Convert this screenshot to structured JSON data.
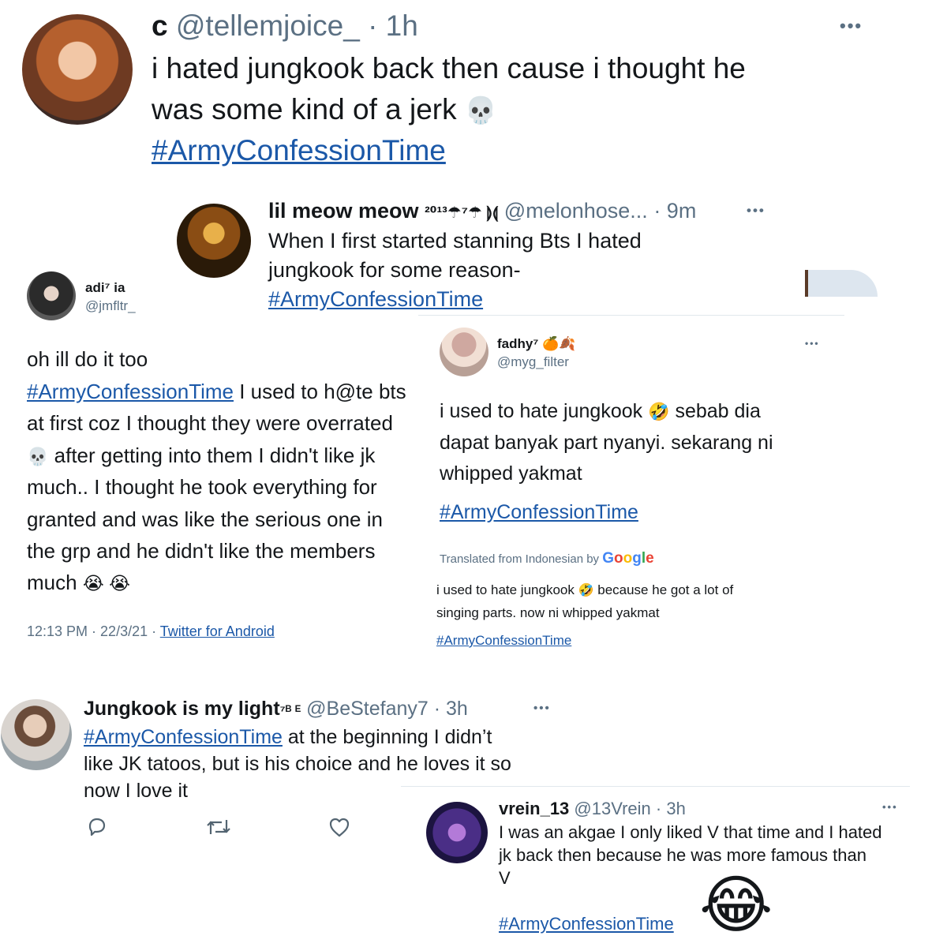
{
  "t1": {
    "name": "c",
    "handle": "@tellemjoice_",
    "time": "· 1h",
    "lines": [
      "i hated jungkook back then cause i thought he",
      "was some kind of a jerk"
    ],
    "emoji": "💀",
    "hashtag": "#ArmyConfessionTime",
    "more": "•••"
  },
  "t2": {
    "name": "lil meow meow",
    "name_suffix": "²⁰¹³☂⁷☂ ⟭⟬",
    "handle": "@melonhose...",
    "time": "· 9m",
    "lines": [
      "When I first started stanning Bts I hated",
      "jungkook for some reason-"
    ],
    "hashtag": "#ArmyConfessionTime",
    "more": "•••"
  },
  "t3": {
    "name": "adi⁷ ia",
    "handle": "@jmfltr_",
    "line1": "oh ill do it too",
    "hashtag": "#ArmyConfessionTime",
    "line2_rest": " I used to h@te bts",
    "line3": "at first coz I thought they were overrated",
    "emoji_skull": "💀",
    "line4_rest": " after getting into them I didn't like jk",
    "line5": "much.. I thought he took everything for",
    "line6": "granted and was like the serious one in",
    "line7": "the grp and he didn't like the members",
    "line8": "much",
    "emoji_cry": "😭 😭",
    "meta": "12:13 PM · 22/3/21 · ",
    "source": "Twitter for Android"
  },
  "t4": {
    "name": "fadhy⁷",
    "name_emoji": "🍊🍂",
    "handle": "@myg_filter",
    "more": "•••",
    "line1a": "i used to hate jungkook",
    "emoji_rofl": "🤣",
    "line1b": " sebab dia",
    "line2": "dapat banyak part nyanyi. sekarang ni",
    "line3": "whipped yakmat",
    "hashtag": "#ArmyConfessionTime",
    "translated_label": "Translated from Indonesian by",
    "google_letters": [
      "G",
      "o",
      "o",
      "g",
      "l",
      "e"
    ],
    "tr_line1a": "i used to hate jungkook",
    "tr_line1b": " because he got a lot of",
    "tr_line2": "singing parts. now ni whipped yakmat",
    "tr_hashtag": "#ArmyConfessionTime"
  },
  "t5": {
    "name": "Jungkook is my light",
    "name_suffix": "⁷ᴮ ᴱ",
    "handle": "@BeStefany7",
    "time": "· 3h",
    "more": "•••",
    "hashtag": "#ArmyConfessionTime",
    "line1_rest": " at the beginning I didn’t",
    "line2": "like JK tatoos, but is his choice and he loves it so",
    "line3": "now I love it"
  },
  "t6": {
    "name": "vrein_13",
    "handle": "@13Vrein",
    "time": "· 3h",
    "more": "•••",
    "line1": "I was an akgae I only liked V that time and I hated",
    "line2": "jk back then because he was more famous than",
    "line3": "V",
    "emoji": "😂",
    "hashtag": "#ArmyConfessionTime"
  },
  "colors": {
    "link": "#1b58a8",
    "secondary": "#5b7083",
    "text": "#14171a",
    "google_blue": "#4285f4",
    "google_red": "#ea4335",
    "google_yellow": "#fbbc05",
    "google_green": "#34a853"
  }
}
